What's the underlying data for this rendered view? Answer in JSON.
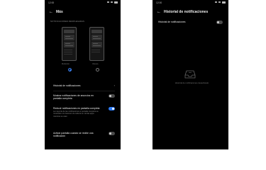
{
  "left_screen": {
    "status_time": "12:00",
    "title": "Más",
    "section_label": "NOTIFICACIONES DESPLEGADAS",
    "layouts": [
      {
        "caption": "Multicolor",
        "selected": true
      },
      {
        "caption": "Vistoso",
        "selected": false
      }
    ],
    "settings_row": {
      "label": "Historial de notificaciones"
    },
    "toggles": [
      {
        "label": "Mostrar notificaciones de anuncios en pantalla completa",
        "sub": "",
        "on": false
      },
      {
        "label": "Reducir notificaciones en pantalla completa",
        "sub": "La mayoría de las notificaciones a pantalla completa se mostrarán con banners de cabeza en ciertas apps mientras se usan",
        "on": true
      },
      {
        "label": "Activar pantalla cuando se recibe una notificación",
        "sub": "",
        "on": false
      }
    ]
  },
  "right_screen": {
    "status_time": "12:00",
    "title": "Historial de notificaciones",
    "history_row": {
      "label": "Historial de notificaciones",
      "on": false
    },
    "empty_state": {
      "icon": "inbox-tray-icon",
      "text": "Historial de notificaciones desactivado"
    }
  },
  "colors": {
    "accent": "#2f7cf6",
    "background": "#000000",
    "text": "#e8e8e8"
  }
}
